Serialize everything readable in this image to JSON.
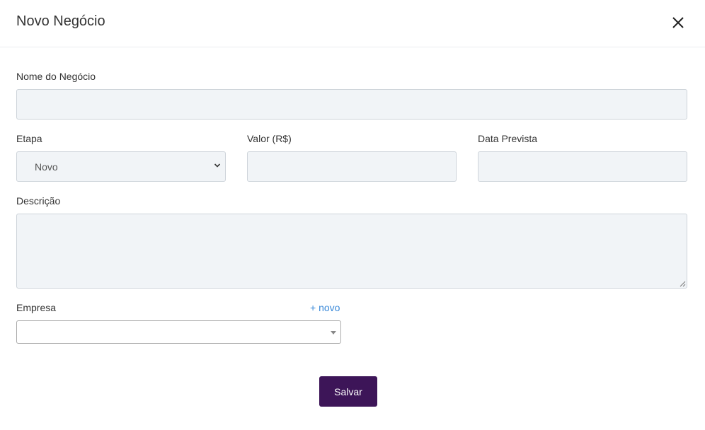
{
  "modal": {
    "title": "Novo Negócio"
  },
  "form": {
    "name_label": "Nome do Negócio",
    "name_value": "",
    "stage_label": "Etapa",
    "stage_selected": "Novo",
    "value_label": "Valor (R$)",
    "value_value": "",
    "date_label": "Data Prevista",
    "date_value": "",
    "description_label": "Descrição",
    "description_value": "",
    "company_label": "Empresa",
    "company_value": "",
    "company_new_link": "+ novo",
    "save_label": "Salvar"
  },
  "icons": {
    "close": "close-icon",
    "stage_chevron": "chevron-down-icon",
    "company_caret": "caret-down-icon"
  },
  "colors": {
    "primary_button": "#3d1558",
    "link": "#3b8ad9",
    "input_bg": "#f1f4f7"
  }
}
